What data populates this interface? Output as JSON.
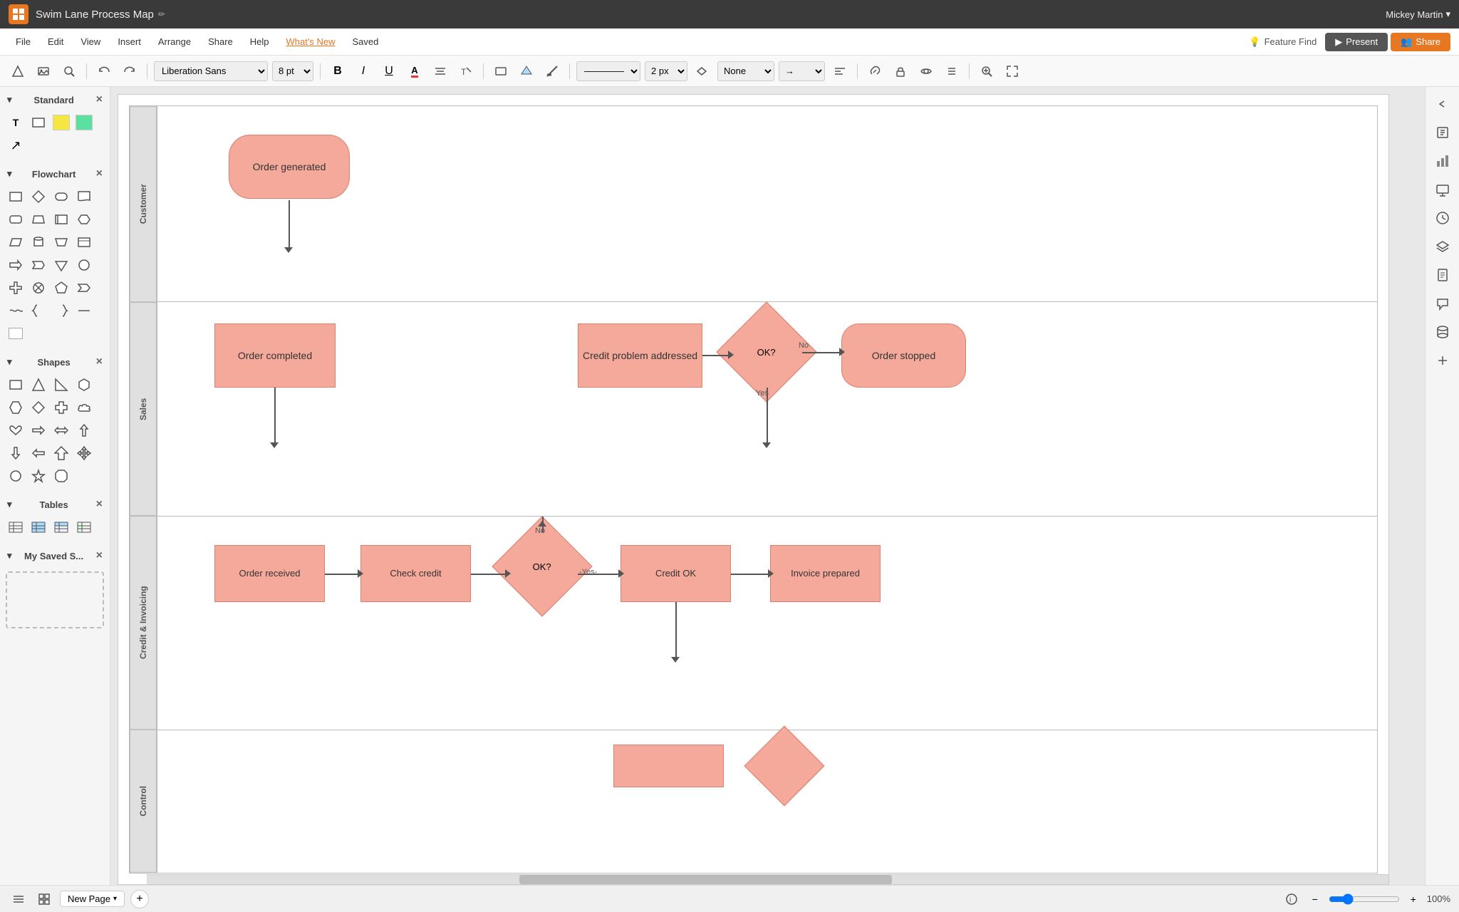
{
  "topbar": {
    "app_icon": "⊞",
    "title": "Swim Lane Process Map",
    "edit_icon": "✏",
    "user": "Mickey Martin",
    "user_arrow": "▾"
  },
  "menubar": {
    "items": [
      {
        "label": "File",
        "active": false
      },
      {
        "label": "Edit",
        "active": false
      },
      {
        "label": "View",
        "active": false
      },
      {
        "label": "Insert",
        "active": false
      },
      {
        "label": "Arrange",
        "active": false
      },
      {
        "label": "Share",
        "active": false
      },
      {
        "label": "Help",
        "active": false
      },
      {
        "label": "What's New",
        "active": true
      },
      {
        "label": "Saved",
        "active": false
      }
    ],
    "feature_find": "Feature Find",
    "present": "Present",
    "share": "Share"
  },
  "toolbar": {
    "font_family": "Liberation Sans",
    "font_size": "8 pt",
    "bold": "B",
    "italic": "I",
    "underline": "U",
    "line_width": "2 px",
    "connection_style": "None",
    "arrow_style": "→"
  },
  "left_panel": {
    "sections": [
      {
        "title": "Standard",
        "closable": true
      },
      {
        "title": "Flowchart",
        "closable": true
      },
      {
        "title": "Shapes",
        "closable": true
      },
      {
        "title": "Tables",
        "closable": true
      },
      {
        "title": "My Saved S...",
        "closable": true
      }
    ]
  },
  "diagram": {
    "lanes": [
      {
        "label": "Customer"
      },
      {
        "label": "Sales"
      },
      {
        "label": "Credit & Invoicing"
      },
      {
        "label": "Control"
      }
    ],
    "shapes": [
      {
        "id": "order-generated",
        "text": "Order generated",
        "type": "rounded"
      },
      {
        "id": "order-completed",
        "text": "Order completed",
        "type": "rect"
      },
      {
        "id": "credit-problem",
        "text": "Credit problem addressed",
        "type": "rect"
      },
      {
        "id": "ok-diamond-1",
        "text": "OK?",
        "type": "diamond"
      },
      {
        "id": "order-stopped",
        "text": "Order stopped",
        "type": "rounded"
      },
      {
        "id": "order-received",
        "text": "Order received",
        "type": "rect"
      },
      {
        "id": "check-credit",
        "text": "Check credit",
        "type": "rect"
      },
      {
        "id": "ok-diamond-2",
        "text": "OK?",
        "type": "diamond"
      },
      {
        "id": "credit-ok",
        "text": "Credit OK",
        "type": "rect"
      },
      {
        "id": "invoice-prepared",
        "text": "Invoice prepared",
        "type": "rect"
      }
    ],
    "arrow_labels": [
      {
        "text": "No",
        "position": "right-of-ok1"
      },
      {
        "text": "Yes",
        "position": "below-ok1"
      },
      {
        "text": "No",
        "position": "above-ok2"
      },
      {
        "text": "-Yes-",
        "position": "right-of-ok2"
      }
    ]
  },
  "bottombar": {
    "page_tab": "New Page",
    "page_arrow": "▾",
    "zoom_percent": "100%"
  }
}
